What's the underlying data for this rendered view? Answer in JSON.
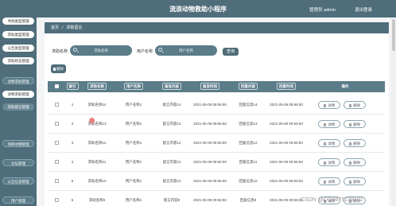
{
  "header": {
    "title": "流浪动物救助小程序",
    "user_label": "管理员 admin",
    "logout_label": "退出登录"
  },
  "sidebar": {
    "items": [
      {
        "label": "寻找类型管理"
      },
      {
        "label": "求助类型管理"
      },
      {
        "label": "公告类型管理"
      },
      {
        "label": "求助状态管理"
      },
      {
        "label": "动物求助管理"
      },
      {
        "label": "动物求助管理"
      },
      {
        "label": "求助留言管理"
      },
      {
        "label": "领养动物管理"
      },
      {
        "label": "论坛管理"
      },
      {
        "label": "公告信息管理"
      },
      {
        "label": "用户管理"
      }
    ]
  },
  "breadcrumb": {
    "home": "首页",
    "separator": "/",
    "current": "求助留言"
  },
  "search": {
    "field1_label": "求助名称",
    "field1_placeholder": "求助名称",
    "field2_label": "用户名称",
    "field2_placeholder": "用户名称",
    "button_label": "查询"
  },
  "toolbar": {
    "delete_label": "删除"
  },
  "table": {
    "headers": [
      "索引",
      "求助名称",
      "用户名称",
      "留言内容",
      "留言时间",
      "回复内容",
      "回复时间",
      "操作"
    ],
    "rows": [
      {
        "index": "1",
        "name": "求助名称14",
        "user": "用户名称1",
        "message": "留言内容14",
        "msg_time": "2021-05-09 09:56:50",
        "reply": "回复信息14",
        "reply_time": "2021-05-09 09:56:50"
      },
      {
        "index": "2",
        "name": "求助名称13",
        "user": "用户名称1",
        "message": "留言内容13",
        "msg_time": "2021-05-09 09:56:50",
        "reply": "回复信息13",
        "reply_time": "2021-05-09 09:56:50"
      },
      {
        "index": "3",
        "name": "求助名称12",
        "user": "用户名称1",
        "message": "留言内容12",
        "msg_time": "2021-05-09 09:56:50",
        "reply": "回复信息12",
        "reply_time": "2021-05-09 09:56:50"
      },
      {
        "index": "4",
        "name": "求助名称11",
        "user": "用户名称1",
        "message": "留言内容11",
        "msg_time": "2021-05-09 09:56:50",
        "reply": "回复信息11",
        "reply_time": "2021-05-09 09:56:50"
      },
      {
        "index": "5",
        "name": "求助名称10",
        "user": "用户名称1",
        "message": "留言内容10",
        "msg_time": "2021-05-09 09:56:50",
        "reply": "回复信息10",
        "reply_time": "2021-05-09 09:56:50"
      },
      {
        "index": "6",
        "name": "求助名称9",
        "user": "用户名称1",
        "message": "留言内容9",
        "msg_time": "2021-05-09 09:56:50",
        "reply": "回复信息9",
        "reply_time": "2021-05-09 09:56:50"
      }
    ],
    "detail_label": "详情",
    "delete_label": "删除"
  },
  "watermark": "CSDN @QQ3679239102",
  "colors": {
    "primary": "#4f6d7a",
    "secondary": "#5b7c89",
    "background": "#f2f4f5"
  }
}
